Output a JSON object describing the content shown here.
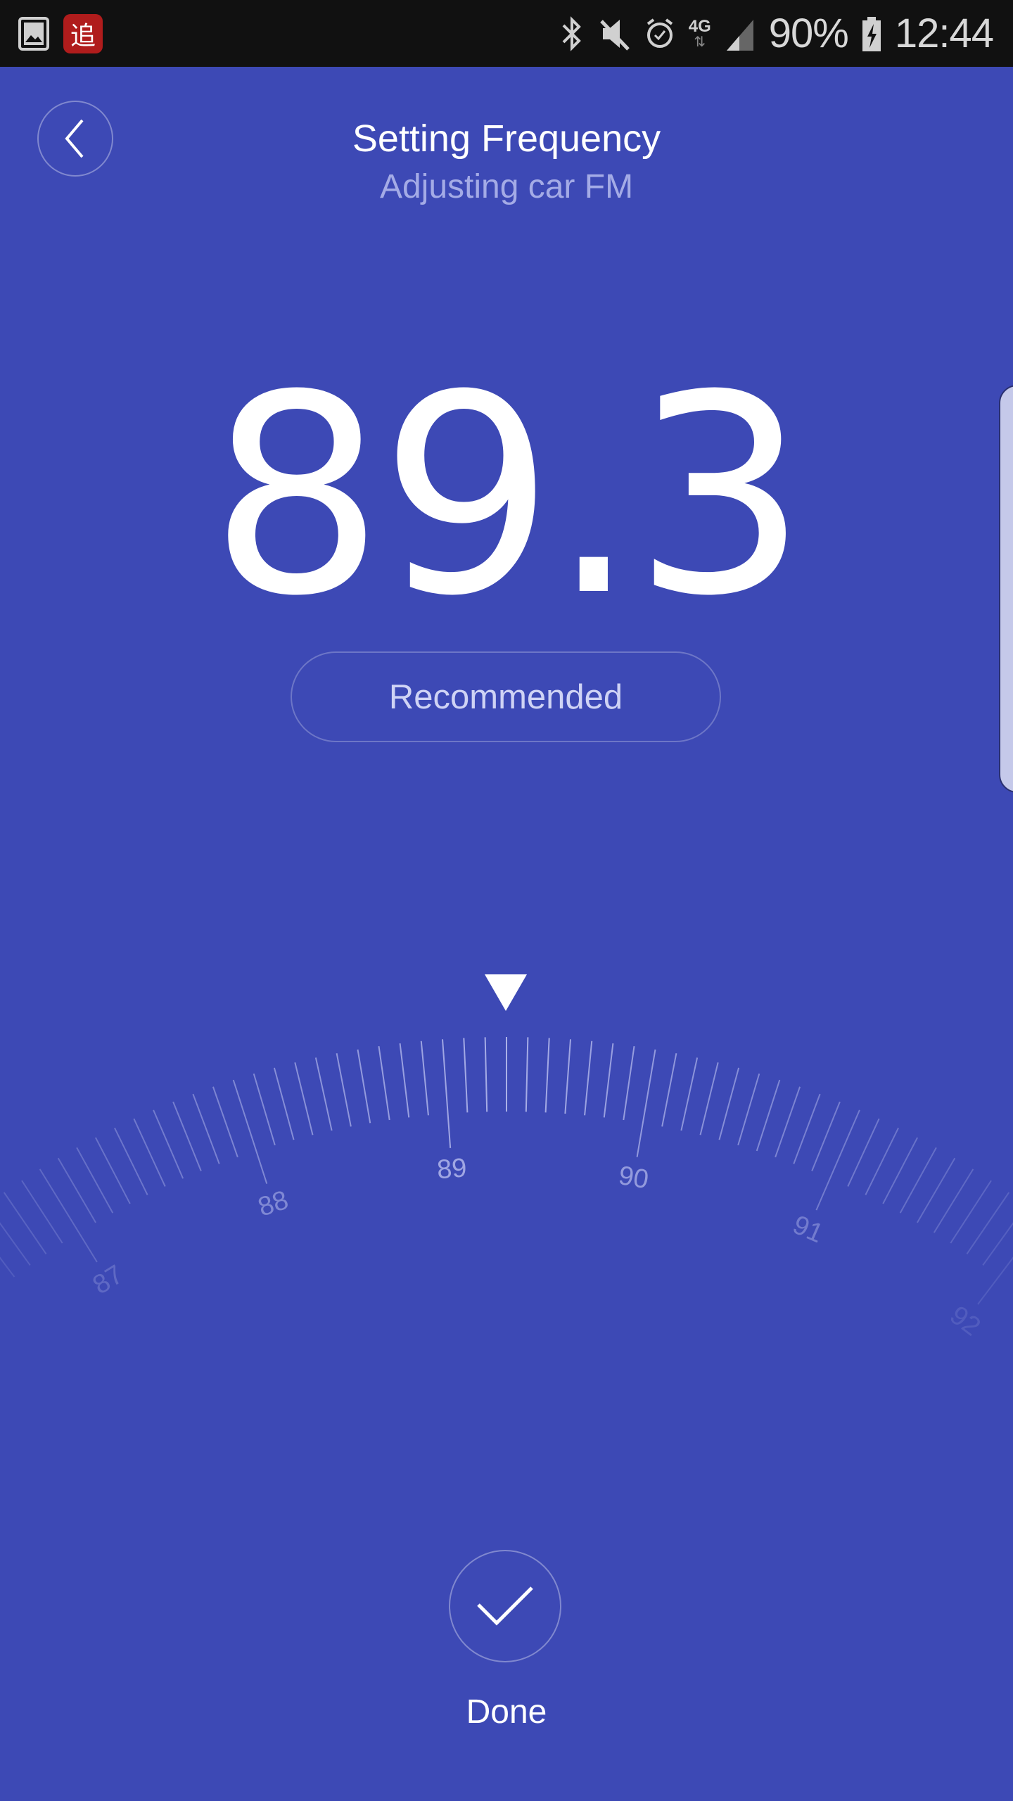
{
  "status_bar": {
    "left_icons": [
      "gallery-icon",
      "app-notification-icon"
    ],
    "app_icon_glyph": "追",
    "right_icons": [
      "bluetooth-icon",
      "mute-icon",
      "alarm-icon",
      "4g-data-icon",
      "signal-icon",
      "battery-charging-icon"
    ],
    "network_label": "4G",
    "battery": "90%",
    "time": "12:44"
  },
  "header": {
    "title": "Setting Frequency",
    "subtitle": "Adjusting car FM"
  },
  "frequency": {
    "value": "89.3",
    "current": 89.3,
    "recommended_label": "Recommended"
  },
  "dial": {
    "min": 86,
    "max": 93,
    "step": 0.1,
    "labels": [
      "87",
      "88",
      "89",
      "90",
      "91",
      "92"
    ],
    "tick_color": "#aab0e8"
  },
  "footer": {
    "done_label": "Done"
  },
  "colors": {
    "background": "#3d49b5",
    "status_bar": "#111111",
    "subtitle": "#a4abe6"
  }
}
